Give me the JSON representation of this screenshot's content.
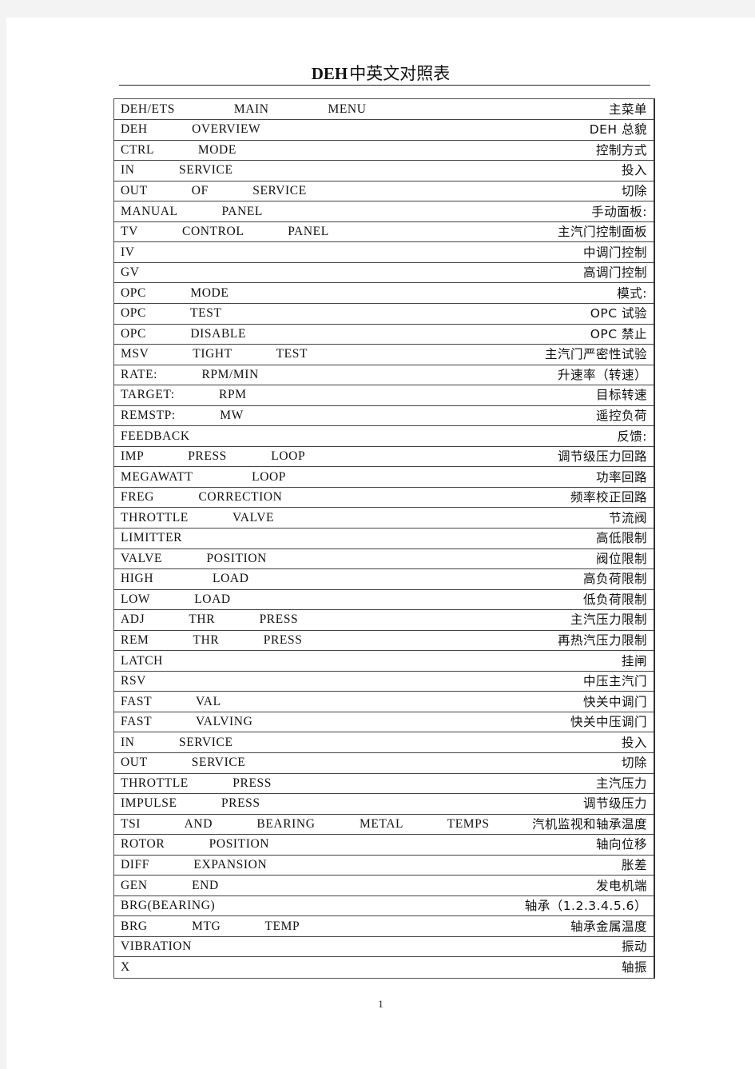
{
  "document": {
    "title_en": "DEH",
    "title_zh": "中英文对照表",
    "page_number": "1"
  },
  "glossary": {
    "rows": [
      {
        "en": "DEH/ETS    MAIN    MENU",
        "zh": "主菜单"
      },
      {
        "en": "DEH   OVERVIEW",
        "zh": "DEH 总貌"
      },
      {
        "en": "CTRL   MODE",
        "zh": "控制方式"
      },
      {
        "en": "IN   SERVICE",
        "zh": "投入"
      },
      {
        "en": "OUT   OF   SERVICE",
        "zh": "切除"
      },
      {
        "en": "MANUAL   PANEL",
        "zh": "手动面板:"
      },
      {
        "en": "TV   CONTROL   PANEL",
        "zh": "主汽门控制面板"
      },
      {
        "en": "IV",
        "zh": "中调门控制"
      },
      {
        "en": "GV",
        "zh": "高调门控制"
      },
      {
        "en": "OPC   MODE",
        "zh": "模式:"
      },
      {
        "en": "OPC   TEST",
        "zh": "OPC 试验"
      },
      {
        "en": "OPC   DISABLE",
        "zh": "OPC 禁止"
      },
      {
        "en": "MSV   TIGHT   TEST",
        "zh": "主汽门严密性试验"
      },
      {
        "en": "RATE:   RPM/MIN",
        "zh": "升速率（转速）"
      },
      {
        "en": "TARGET:   RPM",
        "zh": "目标转速"
      },
      {
        "en": "REMSTP:   MW",
        "zh": "遥控负荷"
      },
      {
        "en": "FEEDBACK",
        "zh": "反馈:"
      },
      {
        "en": "IMP   PRESS   LOOP",
        "zh": "调节级压力回路"
      },
      {
        "en": "MEGAWATT    LOOP",
        "zh": "功率回路"
      },
      {
        "en": "FREG   CORRECTION",
        "zh": "频率校正回路"
      },
      {
        "en": "THROTTLE   VALVE",
        "zh": "节流阀"
      },
      {
        "en": "LIMITTER",
        "zh": "高低限制"
      },
      {
        "en": "VALVE   POSITION",
        "zh": "阀位限制"
      },
      {
        "en": "HIGH    LOAD",
        "zh": "高负荷限制"
      },
      {
        "en": "LOW   LOAD",
        "zh": "低负荷限制"
      },
      {
        "en": "ADJ   THR   PRESS",
        "zh": "主汽压力限制"
      },
      {
        "en": "REM   THR   PRESS",
        "zh": "再热汽压力限制"
      },
      {
        "en": "LATCH",
        "zh": "挂闸"
      },
      {
        "en": "RSV",
        "zh": "中压主汽门"
      },
      {
        "en": "FAST   VAL",
        "zh": "快关中调门"
      },
      {
        "en": "FAST   VALVING",
        "zh": "快关中压调门"
      },
      {
        "en": "IN   SERVICE",
        "zh": "投入"
      },
      {
        "en": "OUT   SERVICE",
        "zh": "切除"
      },
      {
        "en": "THROTTLE   PRESS",
        "zh": "主汽压力"
      },
      {
        "en": "IMPULSE   PRESS",
        "zh": "调节级压力"
      },
      {
        "en": "TSI   AND   BEARING   METAL   TEMPS",
        "zh": "汽机监视和轴承温度"
      },
      {
        "en": "ROTOR   POSITION",
        "zh": "轴向位移"
      },
      {
        "en": "DIFF   EXPANSION",
        "zh": "胀差"
      },
      {
        "en": "GEN   END",
        "zh": "发电机端"
      },
      {
        "en": "BRG(BEARING)",
        "zh": "轴承（1.2.3.4.5.6）"
      },
      {
        "en": "BRG   MTG   TEMP",
        "zh": "轴承金属温度"
      },
      {
        "en": "VIBRATION",
        "zh": "振动"
      },
      {
        "en": "X",
        "zh": "轴振"
      }
    ]
  }
}
